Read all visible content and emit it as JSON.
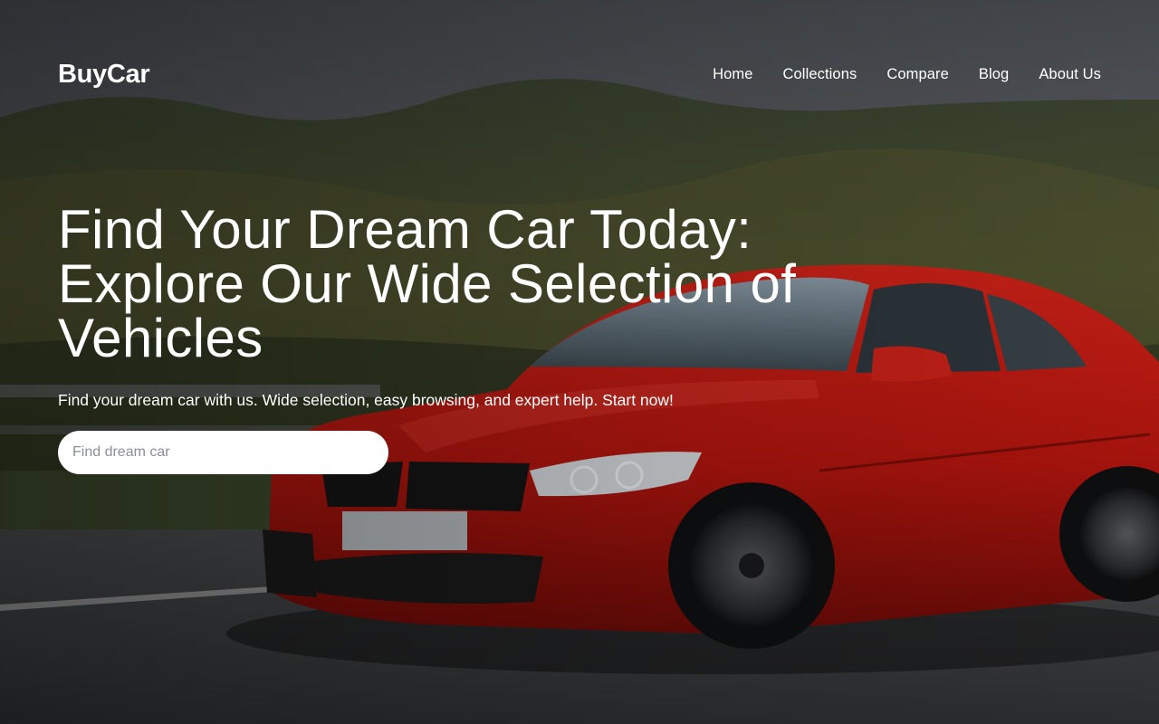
{
  "brand": {
    "name": "BuyCar"
  },
  "nav": {
    "items": [
      {
        "label": "Home"
      },
      {
        "label": "Collections"
      },
      {
        "label": "Compare"
      },
      {
        "label": "Blog"
      },
      {
        "label": "About Us"
      }
    ]
  },
  "hero": {
    "headline": "Find Your Dream Car Today: Explore Our Wide Selection of Vehicles",
    "subtitle": "Find your dream car with us. Wide selection, easy browsing, and expert help. Start now!",
    "search_placeholder": "Find dream car",
    "image": "red-sports-coupe-on-road",
    "colors": {
      "text": "#ffffff",
      "search_bg": "#ffffff",
      "car": "#c4160f"
    }
  }
}
